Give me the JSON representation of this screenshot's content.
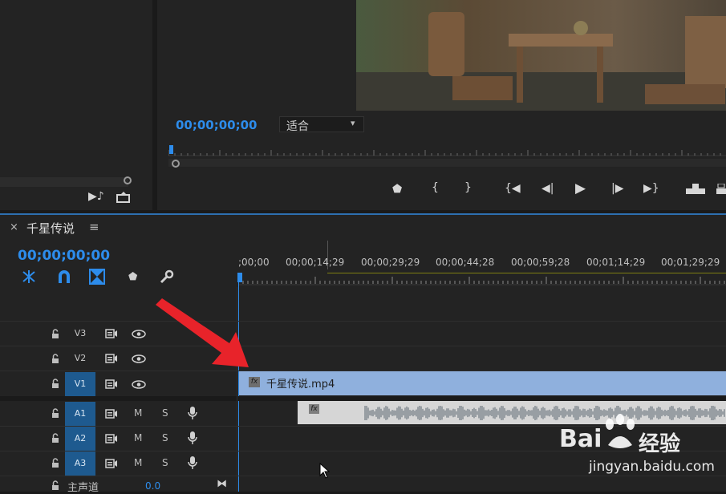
{
  "program_monitor": {
    "timecode": "00;00;00;00",
    "zoom_label": "适合"
  },
  "timeline": {
    "sequence_name": "千星传说",
    "timecode": "00;00;00;00",
    "ruler_labels": [
      ";00;00",
      "00;00;14;29",
      "00;00;29;29",
      "00;00;44;28",
      "00;00;59;28",
      "00;01;14;29",
      "00;01;29;29"
    ],
    "tracks": {
      "V3": "V3",
      "V2": "V2",
      "V1": "V1",
      "A1": "A1",
      "A2": "A2",
      "A3": "A3",
      "mute": "M",
      "solo": "S"
    },
    "master_label": "主声道",
    "master_value": "0.0",
    "clip_name": "千星传说.mp4",
    "fx_label": "fx"
  },
  "watermark": {
    "brand": "Bai",
    "brand_cn": "经验",
    "url": "jingyan.baidu.com"
  },
  "colors": {
    "accent": "#2d8ceb",
    "clip_video": "#8fb0dd",
    "arrow": "#e8232a"
  }
}
